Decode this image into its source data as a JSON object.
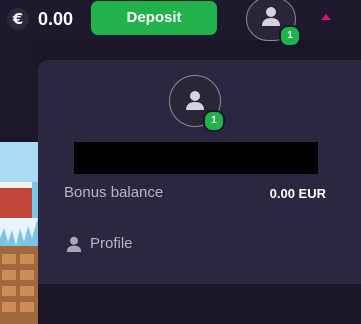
{
  "header": {
    "currency_symbol": "€",
    "balance": "0.00",
    "deposit_label": "Deposit",
    "notification_count": "1"
  },
  "account_menu": {
    "notification_count": "1",
    "bonus_balance_label": "Bonus balance",
    "bonus_balance_value": "0.00 EUR",
    "items": [
      {
        "label": "Profile",
        "icon": "user-icon"
      }
    ]
  },
  "colors": {
    "background": "#1a1628",
    "menu_background": "#2b2740",
    "deposit_green": "#22b24c",
    "badge_green": "#1fb34a",
    "caret_pink": "#e0127a"
  }
}
